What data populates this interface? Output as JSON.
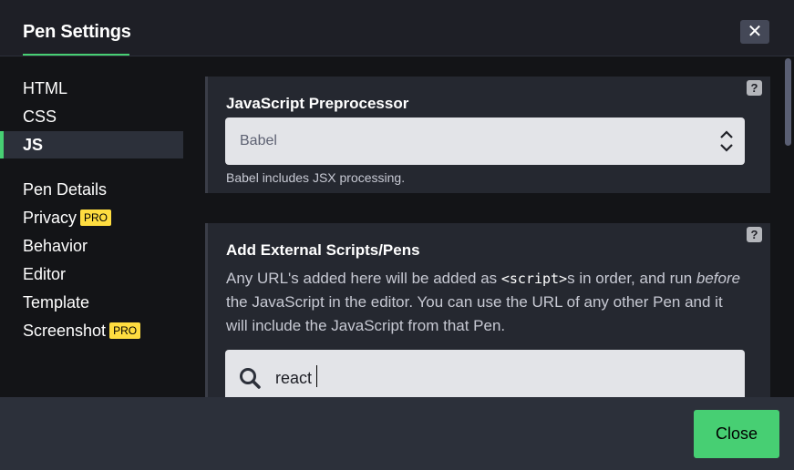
{
  "header": {
    "title": "Pen Settings",
    "close_icon": "close-icon"
  },
  "sidebar": {
    "items": [
      {
        "label": "HTML",
        "active": false
      },
      {
        "label": "CSS",
        "active": false
      },
      {
        "label": "JS",
        "active": true
      },
      {
        "label": "Pen Details",
        "active": false
      },
      {
        "label": "Privacy",
        "active": false,
        "badge": "PRO"
      },
      {
        "label": "Behavior",
        "active": false
      },
      {
        "label": "Editor",
        "active": false
      },
      {
        "label": "Template",
        "active": false
      },
      {
        "label": "Screenshot",
        "active": false,
        "badge": "PRO"
      }
    ]
  },
  "preprocessor": {
    "heading": "JavaScript Preprocessor",
    "help": "?",
    "selected": "Babel",
    "hint": "Babel includes JSX processing."
  },
  "external": {
    "heading": "Add External Scripts/Pens",
    "help": "?",
    "desc_1": "Any URL's added here will be added as ",
    "desc_code": "<script>",
    "desc_2": "s in order, and run ",
    "desc_em": "before",
    "desc_3": " the JavaScript in the editor. You can use the URL of any other Pen and it will include the JavaScript from that Pen.",
    "search_value": "react"
  },
  "footer": {
    "close_label": "Close"
  },
  "colors": {
    "accent": "#47cf73",
    "pro_badge": "#ffdd40",
    "background": "#1e1f26"
  }
}
